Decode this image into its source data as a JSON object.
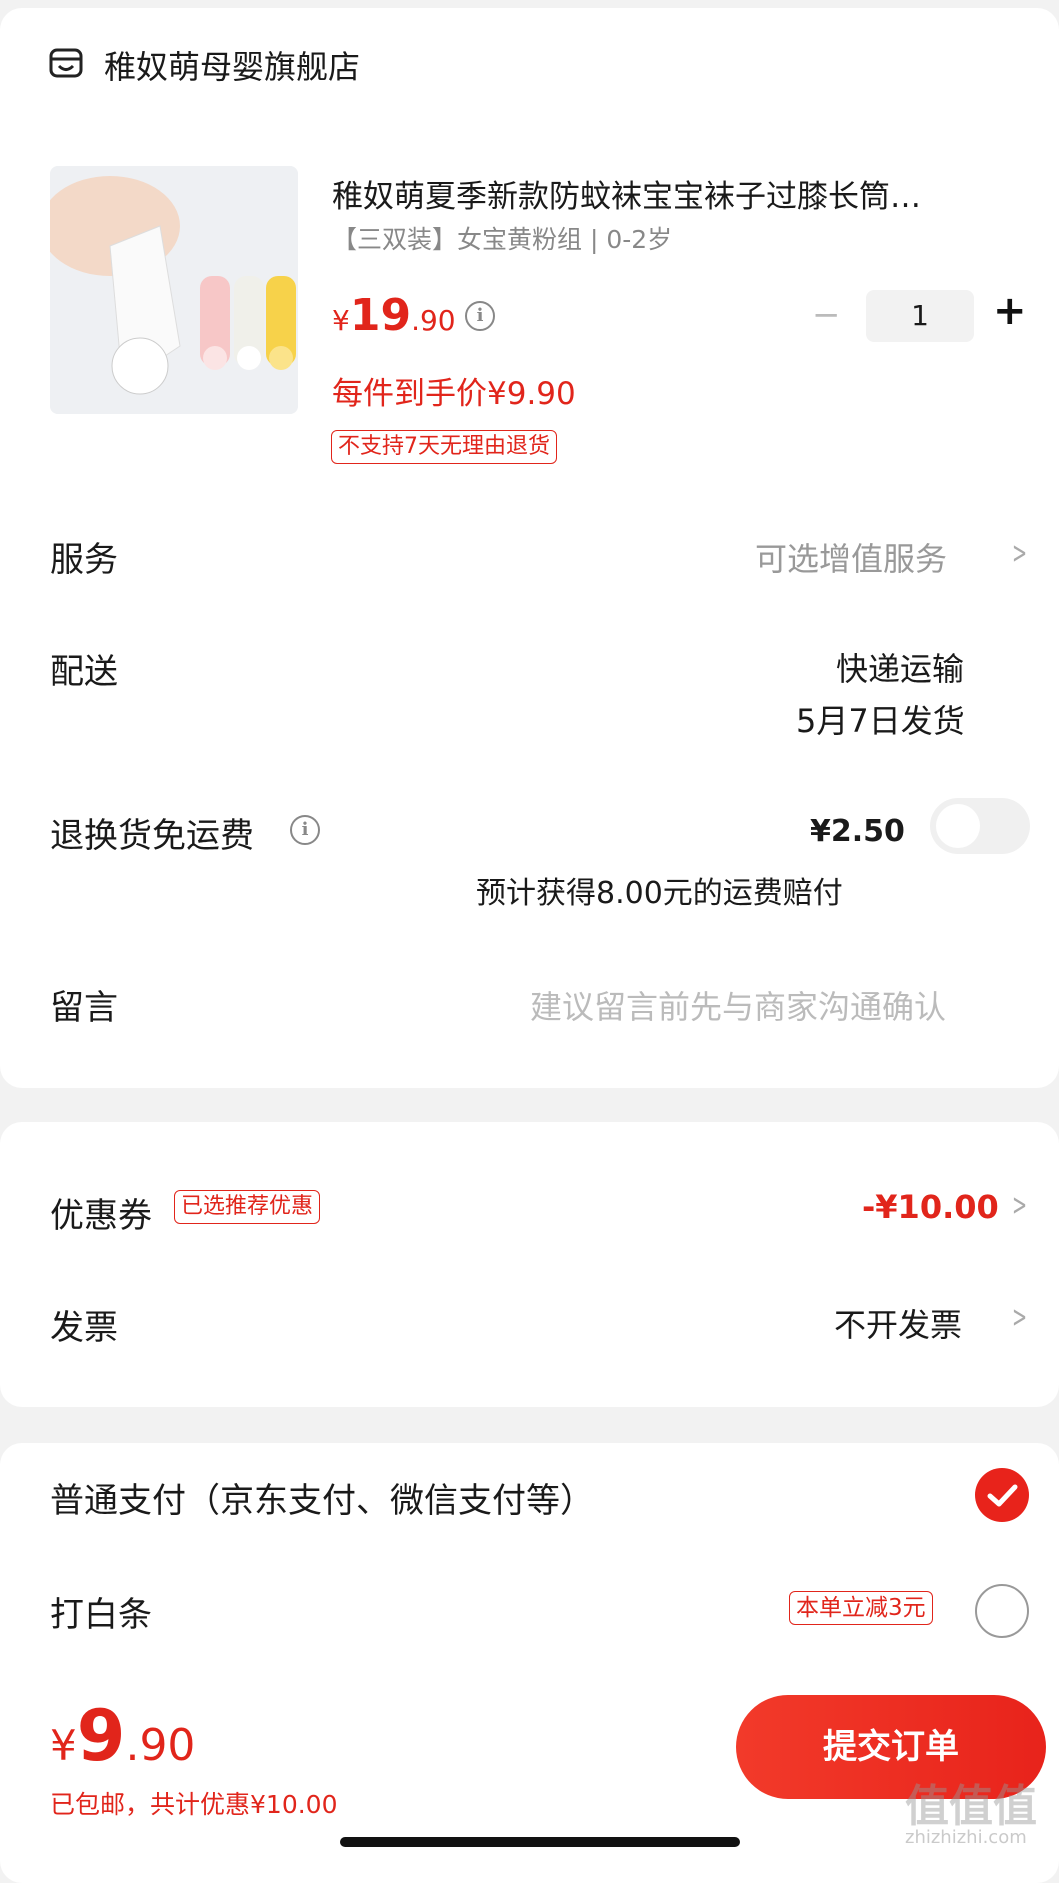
{
  "store": {
    "icon": "store-icon",
    "name": "稚奴萌母婴旗舰店"
  },
  "product": {
    "title": "稚奴萌夏季新款防蚊袜宝宝袜子过膝长筒…",
    "spec": "【三双装】女宝黄粉组 | 0-2岁",
    "price_symbol": "¥",
    "price_int": "19",
    "price_dec": ".90",
    "final_price": "每件到手价¥9.90",
    "return_tag": "不支持7天无理由退货",
    "quantity": "1",
    "minus": "−",
    "plus": "+"
  },
  "service": {
    "label": "服务",
    "value": "可选增值服务"
  },
  "delivery": {
    "label": "配送",
    "method": "快递运输",
    "date": "5月7日发货"
  },
  "return_shipping": {
    "label": "退换货免运费",
    "price": "¥2.50",
    "note": "预计获得8.00元的运费赔付",
    "enabled": false
  },
  "message": {
    "label": "留言",
    "placeholder": "建议留言前先与商家沟通确认"
  },
  "coupon": {
    "label": "优惠券",
    "tag": "已选推荐优惠",
    "value": "-¥10.00"
  },
  "invoice": {
    "label": "发票",
    "value": "不开发票"
  },
  "payment": {
    "normal": {
      "label": "普通支付（京东支付、微信支付等）",
      "selected": true
    },
    "baitiao": {
      "label": "打白条",
      "tag": "本单立减3元",
      "selected": false
    }
  },
  "footer": {
    "price_symbol": "¥",
    "price_int": "9",
    "price_dec": ".90",
    "summary_prefix": "已包邮，共计优惠",
    "summary_amount": "¥10.00",
    "submit_label": "提交订单",
    "watermark": "值值值",
    "watermark_url": "zhizhizhi.com"
  },
  "colors": {
    "accent": "#e1251b",
    "background": "#f2f2f2"
  }
}
